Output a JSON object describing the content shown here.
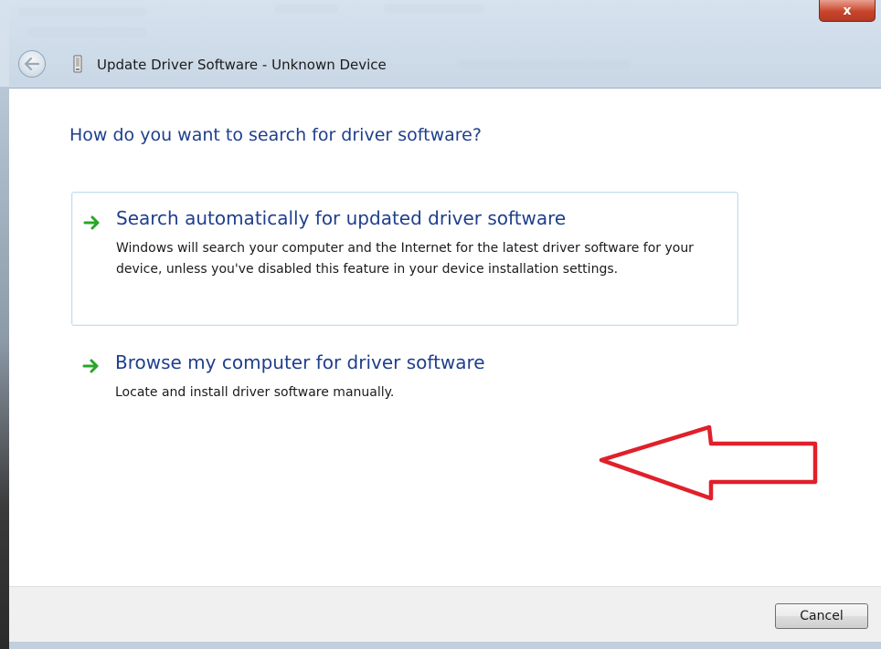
{
  "window": {
    "title": "Update Driver Software - Unknown Device",
    "close_glyph": "x"
  },
  "main": {
    "heading": "How do you want to search for driver software?",
    "options": [
      {
        "title": "Search automatically for updated driver software",
        "description": "Windows will search your computer and the Internet for the latest driver software for your device, unless you've disabled this feature in your device installation settings."
      },
      {
        "title": "Browse my computer for driver software",
        "description": "Locate and install driver software manually."
      }
    ]
  },
  "footer": {
    "cancel_label": "Cancel"
  },
  "icons": {
    "back": "back-arrow-icon",
    "device": "device-icon",
    "option_arrow": "green-arrow-icon",
    "annotation": "red-arrow-annotation"
  },
  "colors": {
    "heading_blue": "#1f3f8c",
    "option_arrow_green": "#2aa52a",
    "annotation_red": "#e0202a",
    "close_red": "#c8452c"
  }
}
